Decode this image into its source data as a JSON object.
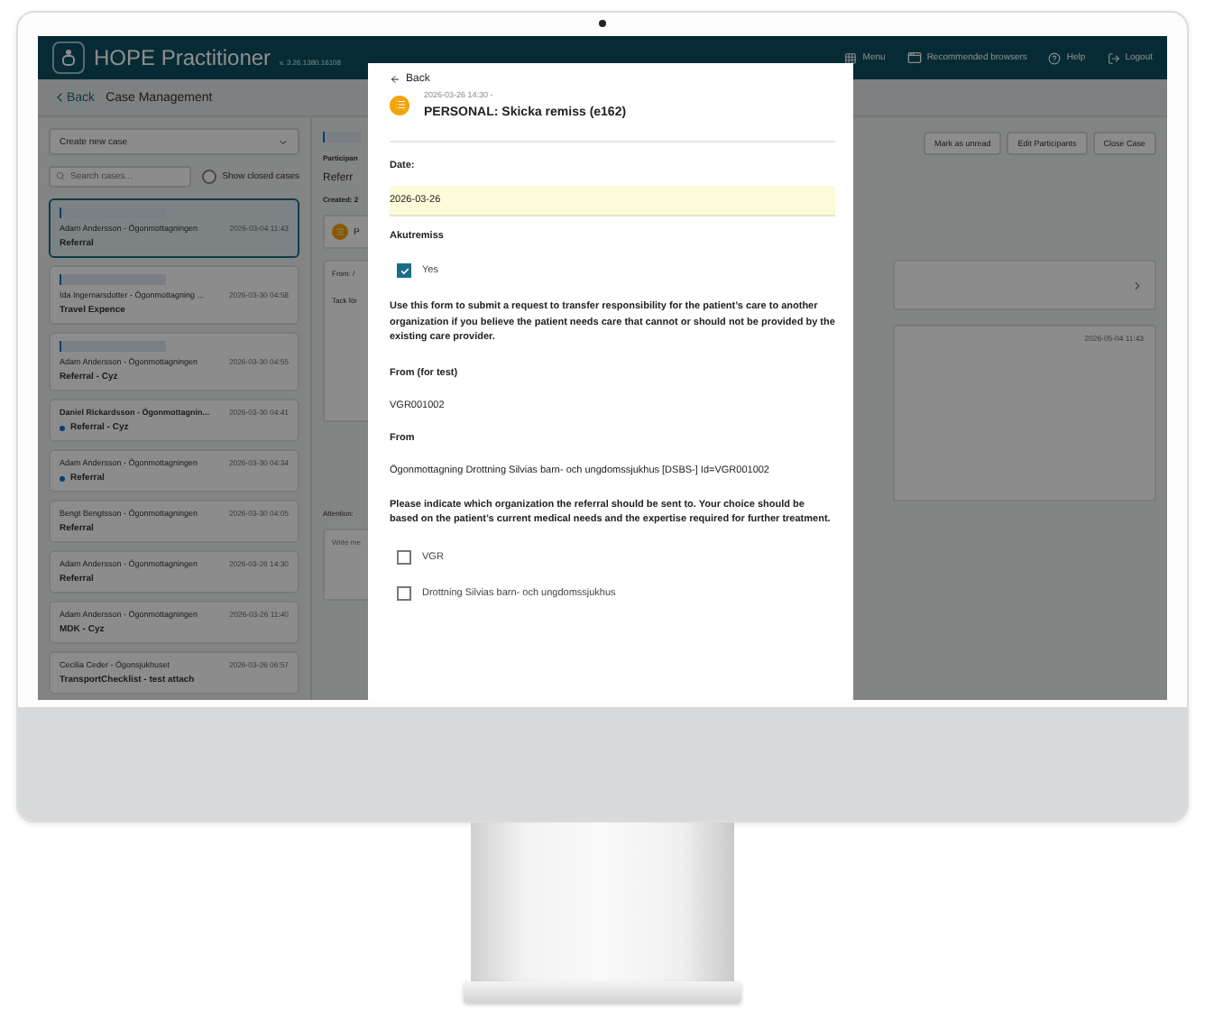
{
  "header": {
    "title": "HOPE Practitioner",
    "version": "v. 3.26.1380.16108",
    "nav": [
      {
        "kind": "menu",
        "label": "Menu"
      },
      {
        "kind": "browser",
        "label": "Recommended browsers"
      },
      {
        "kind": "help",
        "label": "Help"
      },
      {
        "kind": "logout",
        "label": "Logout"
      }
    ]
  },
  "subheader": {
    "back": "Back",
    "title": "Case Management"
  },
  "sidebar": {
    "create_case": "Create new case",
    "search_placeholder": "Search cases...",
    "show_closed": {
      "label": "Show closed cases",
      "checked": false
    },
    "cases": [
      {
        "tagged": true,
        "name": "Adam Andersson - Ögonmottagningen",
        "time": "2026-03-04 11:43",
        "subject": "Referral",
        "selected": true,
        "unread": false,
        "bold": false
      },
      {
        "tagged": true,
        "name": "Ida Ingemarsdotter - Ögonmottagning ...",
        "time": "2026-03-30 04:58",
        "subject": "Travel Expence",
        "selected": false,
        "unread": false,
        "bold": false
      },
      {
        "tagged": true,
        "name": "Adam Andersson - Ögonmottagningen",
        "time": "2026-03-30 04:55",
        "subject": "Referral - Cyz",
        "selected": false,
        "unread": false,
        "bold": false
      },
      {
        "tagged": false,
        "name": "Daniel Rickardsson - Ögonmottagnin...",
        "time": "2026-03-30 04:41",
        "subject": "Referral - Cyz",
        "selected": false,
        "unread": true,
        "bold": true
      },
      {
        "tagged": false,
        "name": "Adam Andersson - Ögonmottagningen",
        "time": "2026-03-30 04:34",
        "subject": "Referral",
        "selected": false,
        "unread": true,
        "bold": false
      },
      {
        "tagged": false,
        "name": "Bengt Bengtsson - Ögonmottagningen",
        "time": "2026-03-30 04:05",
        "subject": "Referral",
        "selected": false,
        "unread": false,
        "bold": false
      },
      {
        "tagged": false,
        "name": "Adam Andersson - Ögonmottagningen",
        "time": "2026-03-26 14:30",
        "subject": "Referral",
        "selected": false,
        "unread": false,
        "bold": false
      },
      {
        "tagged": false,
        "name": "Adam Andersson - Ögonmottagningen",
        "time": "2026-03-26 11:40",
        "subject": "MDK - Cyz",
        "selected": false,
        "unread": false,
        "bold": false
      },
      {
        "tagged": false,
        "name": "Cecilia Ceder - Ögonsjukhuset",
        "time": "2026-03-26 06:57",
        "subject": "TransportChecklist - test attach",
        "selected": false,
        "unread": false,
        "bold": false
      }
    ]
  },
  "case_view": {
    "participants_label": "Participan",
    "subject": "Referr",
    "created": "Created: 2",
    "actions": [
      "Mark as unread",
      "Edit Participants",
      "Close Case"
    ],
    "event_title": "P",
    "message_from": "From: /",
    "message_text": "Tack för",
    "message_time": "2026-05-04 11:43",
    "attention_label": "Attention:",
    "reply_placeholder": "Write me"
  },
  "modal": {
    "back": "Back",
    "timestamp": "2026-03-26 14:30 -",
    "title": "PERSONAL: Skicka remiss (e162)",
    "items": [
      {
        "kind": "label",
        "text": "Date:"
      },
      {
        "kind": "highlight",
        "text": "2026-03-26"
      },
      {
        "kind": "label",
        "text": "Akutremiss"
      },
      {
        "kind": "checkbox",
        "text": "Yes",
        "checked": true
      },
      {
        "kind": "paragraph",
        "text": "Use this form to submit a request to transfer responsibility for the patient’s care to another organization if you believe the patient needs care that cannot or should not be provided by the existing care provider."
      },
      {
        "kind": "label",
        "text": "From (for test)"
      },
      {
        "kind": "value",
        "text": "VGR001002"
      },
      {
        "kind": "label",
        "text": "From"
      },
      {
        "kind": "value",
        "text": "Ögonmottagning Drottning Silvias barn- och ungdomssjukhus [DSBS-] Id=VGR001002"
      },
      {
        "kind": "paragraph",
        "text": "Please indicate which organization the referral should be sent to. Your choice should be based on the patient’s current medical needs and the expertise required for further treatment."
      },
      {
        "kind": "checkbox",
        "text": "VGR",
        "checked": false
      },
      {
        "kind": "checkbox",
        "text": "Drottning Silvias barn- och ungdomssjukhus",
        "checked": false
      }
    ]
  }
}
